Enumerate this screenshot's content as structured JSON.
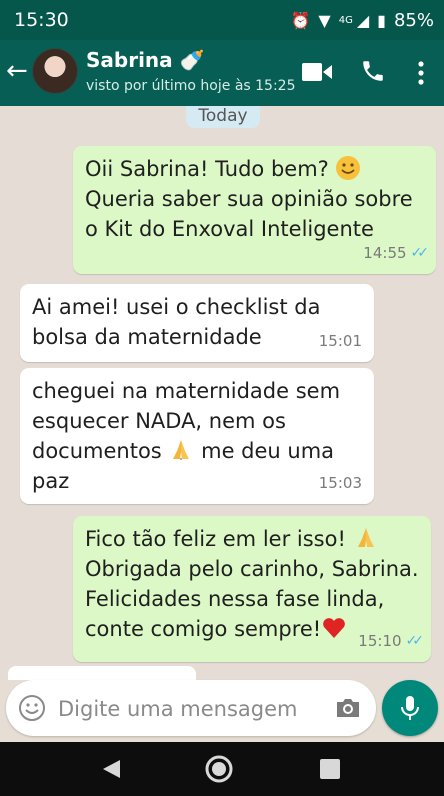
{
  "status_bar": {
    "time": "15:30",
    "network": "4G",
    "battery": "85%"
  },
  "header": {
    "contact_name": "Sabrina 🍼",
    "last_seen": "visto por último hoje às 15:25"
  },
  "chat": {
    "date_chip": "Today",
    "messages": [
      {
        "direction": "outgoing",
        "line1": "Oii Sabrina! Tudo bem?",
        "line2": "Queria saber sua opinião sobre",
        "line3": "o Kit do Enxoval Inteligente",
        "time": "14:55",
        "status": "read"
      },
      {
        "direction": "incoming",
        "line1": "Ai amei! usei o checklist da",
        "line2": "bolsa da maternidade",
        "time": "15:01"
      },
      {
        "direction": "incoming",
        "line1": "cheguei na maternidade sem",
        "line2": "esquecer NADA, nem os",
        "line3a": "documentos",
        "line3b": "me deu uma",
        "line4": "paz",
        "time": "15:03"
      },
      {
        "direction": "outgoing",
        "line1": "Fico tão feliz em ler isso!",
        "line2": "Obrigada pelo carinho, Sabrina.",
        "line3": "Felicidades nessa fase linda,",
        "line4": "conte comigo sempre!",
        "time": "15:10",
        "status": "read"
      }
    ]
  },
  "composer": {
    "placeholder": "Digite uma mensagem"
  },
  "colors": {
    "header": "#075e54",
    "outgoing_bubble": "#dcf8c6",
    "incoming_bubble": "#ffffff",
    "read_ticks": "#4fb6ec",
    "mic_button": "#00897b"
  },
  "icons": [
    "back-arrow-icon",
    "video-call-icon",
    "phone-icon",
    "more-vert-icon",
    "smile-icon",
    "camera-icon",
    "mic-icon",
    "nav-back-icon",
    "nav-home-icon",
    "nav-recent-icon"
  ]
}
